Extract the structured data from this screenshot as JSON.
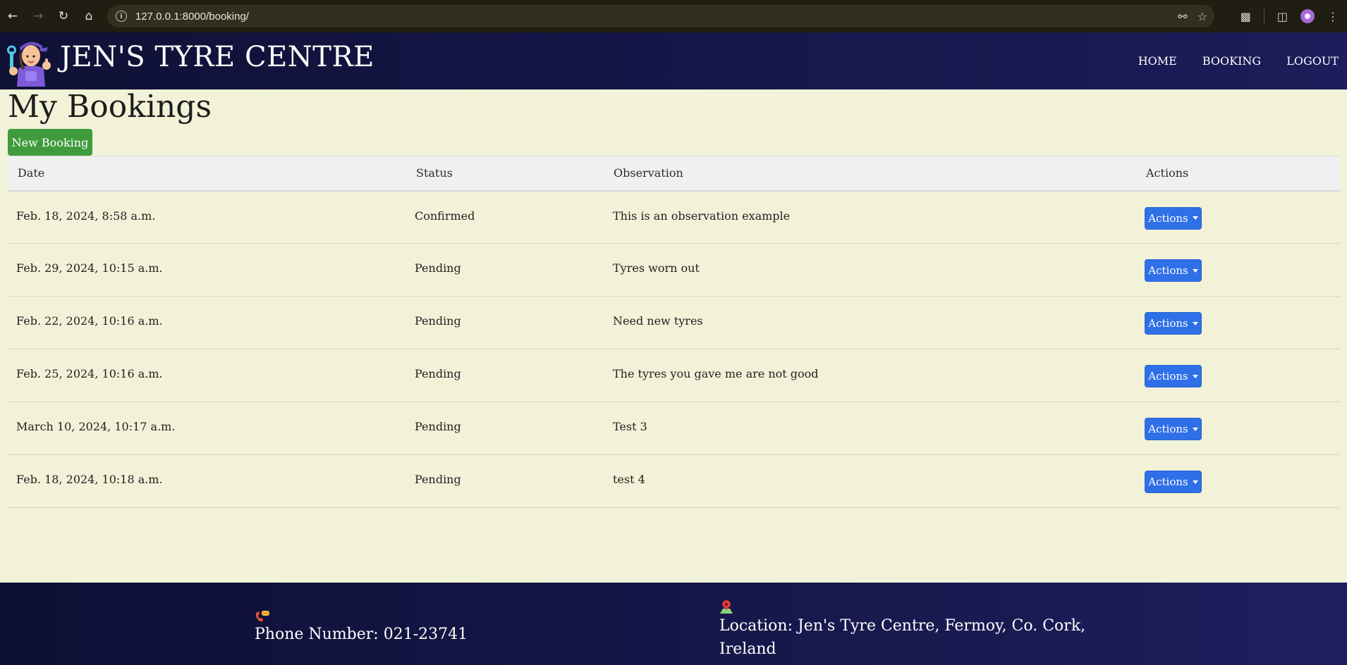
{
  "browser": {
    "url": "127.0.0.1:8000/booking/"
  },
  "header": {
    "brand": "JEN'S TYRE CENTRE",
    "nav": [
      "HOME",
      "BOOKING",
      "LOGOUT"
    ]
  },
  "main": {
    "title": "My Bookings",
    "new_booking_label": "New Booking",
    "columns": [
      "Date",
      "Status",
      "Observation",
      "Actions"
    ],
    "rows": [
      {
        "date": "Feb. 18, 2024, 8:58 a.m.",
        "status": "Confirmed",
        "observation": "This is an observation example",
        "action": "Actions"
      },
      {
        "date": "Feb. 29, 2024, 10:15 a.m.",
        "status": "Pending",
        "observation": "Tyres worn out",
        "action": "Actions"
      },
      {
        "date": "Feb. 22, 2024, 10:16 a.m.",
        "status": "Pending",
        "observation": "Need new tyres",
        "action": "Actions"
      },
      {
        "date": "Feb. 25, 2024, 10:16 a.m.",
        "status": "Pending",
        "observation": "The tyres you gave me are not good",
        "action": "Actions"
      },
      {
        "date": "March 10, 2024, 10:17 a.m.",
        "status": "Pending",
        "observation": "Test 3",
        "action": "Actions"
      },
      {
        "date": "Feb. 18, 2024, 10:18 a.m.",
        "status": "Pending",
        "observation": "test 4",
        "action": "Actions"
      }
    ]
  },
  "footer": {
    "phone": "Phone Number: 021-23741",
    "location": "Location: Jen's Tyre Centre, Fermoy, Co. Cork, Ireland"
  },
  "icons": {
    "phone": "phone-icon",
    "location": "map-pin-icon",
    "logo": "mechanic-logo"
  },
  "colors": {
    "header_bg": "#15164a",
    "page_bg": "#f2f2d8",
    "new_button": "#3f9b3b",
    "actions_button": "#2f6fe8"
  }
}
